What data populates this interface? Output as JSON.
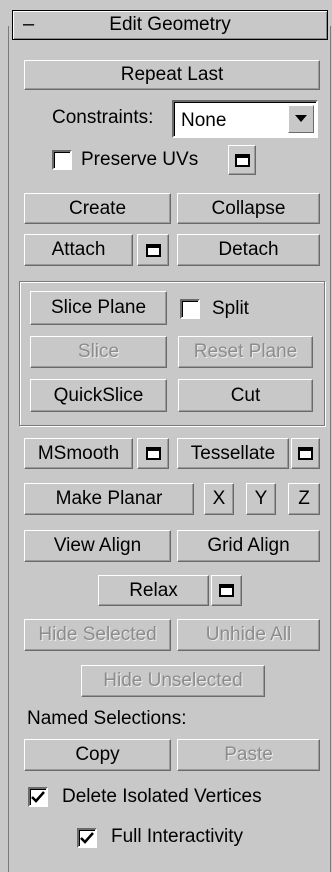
{
  "rollout": {
    "collapse_glyph": "–",
    "title": "Edit Geometry"
  },
  "buttons": {
    "repeat_last": "Repeat Last",
    "create": "Create",
    "collapse": "Collapse",
    "attach": "Attach",
    "detach": "Detach",
    "slice_plane": "Slice Plane",
    "slice": "Slice",
    "reset_plane": "Reset Plane",
    "quickslice": "QuickSlice",
    "cut": "Cut",
    "msmooth": "MSmooth",
    "tessellate": "Tessellate",
    "make_planar": "Make Planar",
    "x": "X",
    "y": "Y",
    "z": "Z",
    "view_align": "View Align",
    "grid_align": "Grid Align",
    "relax": "Relax",
    "hide_selected": "Hide Selected",
    "unhide_all": "Unhide All",
    "hide_unselected": "Hide Unselected",
    "copy": "Copy",
    "paste": "Paste"
  },
  "constraints": {
    "label": "Constraints:",
    "value": "None"
  },
  "checkboxes": {
    "preserve_uvs": {
      "label": "Preserve UVs",
      "checked": false
    },
    "split": {
      "label": "Split",
      "checked": false
    },
    "delete_isolated": {
      "label": "Delete Isolated Vertices",
      "checked": true
    },
    "full_interactivity": {
      "label": "Full Interactivity",
      "checked": true
    }
  },
  "named_selections": {
    "label": "Named Selections:"
  },
  "icons": {
    "settings": "settings-window-icon",
    "dropdown": "dropdown-arrow-icon",
    "check": "checkmark-icon"
  }
}
